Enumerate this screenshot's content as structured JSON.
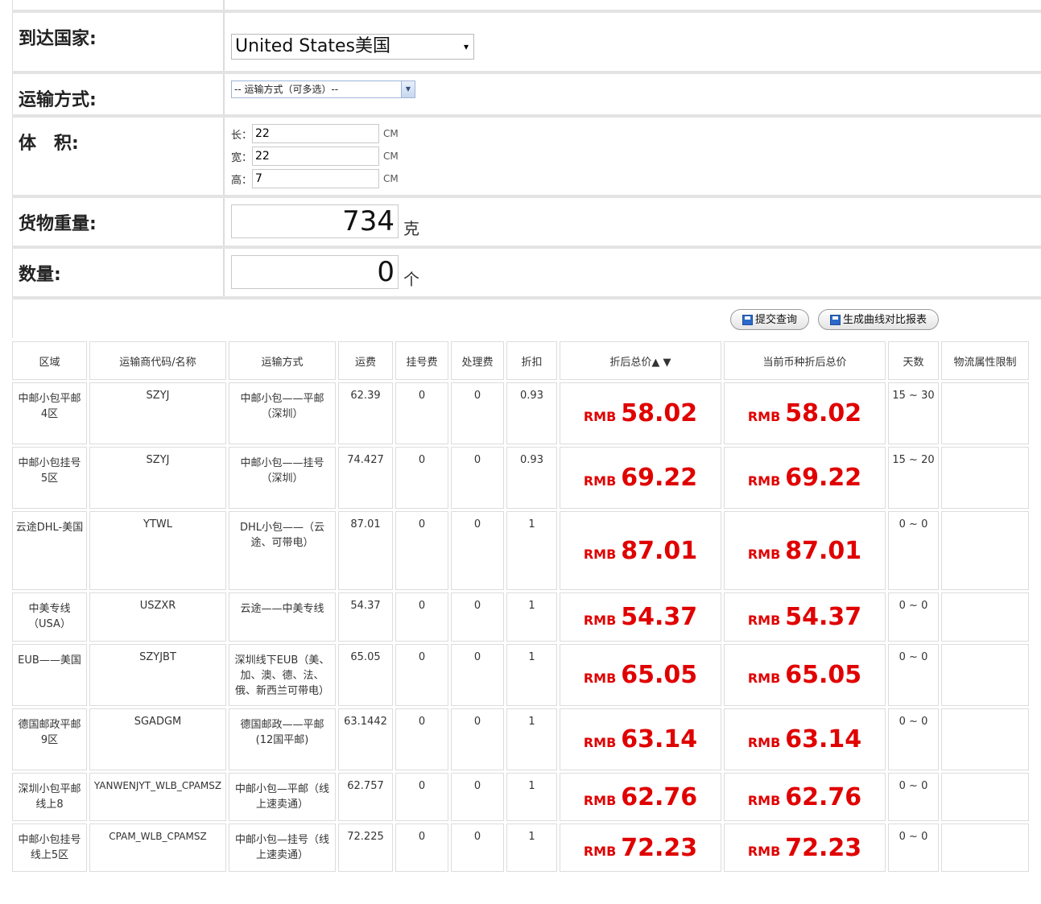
{
  "form": {
    "country_label": "到达国家:",
    "country_value": "United States美国",
    "method_label": "运输方式:",
    "method_value": "-- 运输方式（可多选）--",
    "volume_label": "体　积:",
    "length_label": "长：",
    "length_value": "22",
    "width_label": "宽：",
    "width_value": "22",
    "height_label": "高：",
    "height_value": "7",
    "dim_unit": "CM",
    "weight_label": "货物重量:",
    "weight_value": "734",
    "weight_unit": "克",
    "quantity_label": "数量:",
    "quantity_value": "0",
    "quantity_unit": "个"
  },
  "buttons": {
    "submit": "提交查询",
    "compare": "生成曲线对比报表"
  },
  "table": {
    "headers": [
      "区域",
      "运输商代码/名称",
      "运输方式",
      "运费",
      "挂号费",
      "处理费",
      "折扣",
      "折后总价▲ ▼",
      "当前币种折后总价",
      "天数",
      "物流属性限制"
    ],
    "currency": "RMB",
    "rows": [
      {
        "region": "中邮小包平邮4区",
        "code": "SZYJ",
        "method": "中邮小包——平邮（深圳）",
        "freight": "62.39",
        "reg": "0",
        "handling": "0",
        "discount": "0.93",
        "total": "58.02",
        "cur_total": "58.02",
        "days": "15 ~ 30",
        "limit": ""
      },
      {
        "region": "中邮小包挂号5区",
        "code": "SZYJ",
        "method": "中邮小包——挂号（深圳）",
        "freight": "74.427",
        "reg": "0",
        "handling": "0",
        "discount": "0.93",
        "total": "69.22",
        "cur_total": "69.22",
        "days": "15 ~ 20",
        "limit": ""
      },
      {
        "region": "云途DHL-美国",
        "code": "YTWL",
        "method": "DHL小包——（云途、可带电）",
        "freight": "87.01",
        "reg": "0",
        "handling": "0",
        "discount": "1",
        "total": "87.01",
        "cur_total": "87.01",
        "days": "0 ~ 0",
        "limit": ""
      },
      {
        "region": "中美专线（USA）",
        "code": "USZXR",
        "method": "云途——中美专线",
        "freight": "54.37",
        "reg": "0",
        "handling": "0",
        "discount": "1",
        "total": "54.37",
        "cur_total": "54.37",
        "days": "0 ~ 0",
        "limit": ""
      },
      {
        "region": "EUB——美国",
        "code": "SZYJBT",
        "method": "深圳线下EUB（美、加、澳、德、法、俄、新西兰可带电）",
        "freight": "65.05",
        "reg": "0",
        "handling": "0",
        "discount": "1",
        "total": "65.05",
        "cur_total": "65.05",
        "days": "0 ~ 0",
        "limit": ""
      },
      {
        "region": "德国邮政平邮9区",
        "code": "SGADGM",
        "method": "德国邮政——平邮(12国平邮)",
        "freight": "63.1442",
        "reg": "0",
        "handling": "0",
        "discount": "1",
        "total": "63.14",
        "cur_total": "63.14",
        "days": "0 ~ 0",
        "limit": ""
      },
      {
        "region": "深圳小包平邮线上8",
        "code": "YANWENJYT_WLB_CPAMSZ",
        "method": "中邮小包—平邮（线上速卖通）",
        "freight": "62.757",
        "reg": "0",
        "handling": "0",
        "discount": "1",
        "total": "62.76",
        "cur_total": "62.76",
        "days": "0 ~ 0",
        "limit": ""
      },
      {
        "region": "中邮小包挂号线上5区",
        "code": "CPAM_WLB_CPAMSZ",
        "method": "中邮小包—挂号（线上速卖通）",
        "freight": "72.225",
        "reg": "0",
        "handling": "0",
        "discount": "1",
        "total": "72.23",
        "cur_total": "72.23",
        "days": "0 ~ 0",
        "limit": ""
      }
    ]
  },
  "colors": {
    "price": "#e00000",
    "border": "#dcdcdc"
  }
}
